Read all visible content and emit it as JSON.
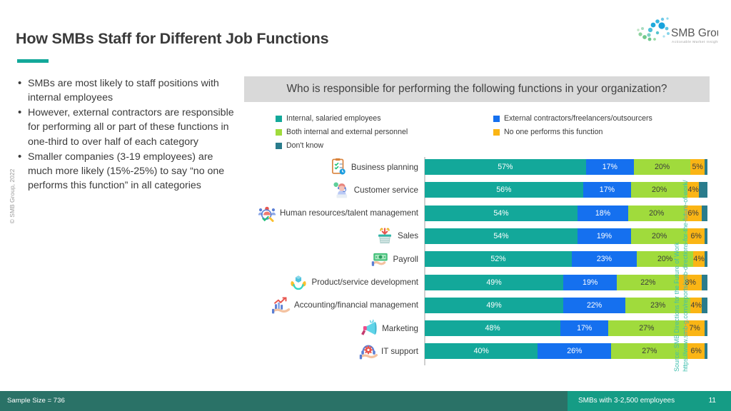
{
  "slide": {
    "title": "How SMBs Staff for Different Job Functions",
    "copyright": "© SMB Group, 2022",
    "accent_color": "#13A89A"
  },
  "logo": {
    "name": "SMB Group",
    "tagline": "Actionable Market Insight"
  },
  "bullets": [
    "SMBs are most likely to staff positions with internal employees",
    "However, external contractors are responsible for performing all or part of these functions in one-third to over half of each category",
    "Smaller companies (3-19 employees) are much more likely  (15%-25%) to say “no one performs this function” in all categories"
  ],
  "question_banner": "Who is responsible for performing the following functions in your organization?",
  "source": {
    "line1": "Source: SMB Directions for the Future of Work",
    "line2": "https://www.smb-g.com/reports/smb-directions-for-the-future-of-work/"
  },
  "footer": {
    "sample_size": "Sample Size = 736",
    "audience": "SMBs with 3-2,500 employees",
    "page_number": "11",
    "left_color": "#2A7267",
    "right_color": "#159C85"
  },
  "chart_data": {
    "type": "bar",
    "subtype": "stacked-horizontal-100",
    "title": "Who is responsible for performing the following functions in your organization?",
    "xlabel": "",
    "ylabel": "",
    "xlim": [
      0,
      100
    ],
    "grid": false,
    "legend_position": "top",
    "categories": [
      "Business planning",
      "Customer service",
      "Human resources/talent management",
      "Sales",
      "Payroll",
      "Product/service development",
      "Accounting/financial management",
      "Marketing",
      "IT support"
    ],
    "category_icons": [
      "clipboard-checklist-icon",
      "customer-service-agent-icon",
      "hr-people-magnifier-icon",
      "sales-basket-icon",
      "payroll-money-icon",
      "product-development-hands-icon",
      "accounting-growth-chart-icon",
      "marketing-megaphone-icon",
      "it-support-headset-gear-icon"
    ],
    "series": [
      {
        "name": "Internal, salaried employees",
        "color": "#13A89A",
        "values": [
          57,
          56,
          54,
          54,
          52,
          49,
          49,
          48,
          40
        ],
        "labels": [
          "57%",
          "56%",
          "54%",
          "54%",
          "52%",
          "49%",
          "49%",
          "48%",
          "40%"
        ]
      },
      {
        "name": "External contractors/freelancers/outsourcers",
        "color": "#1570EF",
        "values": [
          17,
          17,
          18,
          19,
          23,
          19,
          22,
          17,
          26
        ],
        "labels": [
          "17%",
          "17%",
          "18%",
          "19%",
          "23%",
          "19%",
          "22%",
          "17%",
          "26%"
        ]
      },
      {
        "name": "Both internal and external personnel",
        "color": "#A0DB3C",
        "values": [
          20,
          20,
          20,
          20,
          20,
          22,
          23,
          27,
          27
        ],
        "labels": [
          "20%",
          "20%",
          "20%",
          "20%",
          "20%",
          "22%",
          "23%",
          "27%",
          "27%"
        ]
      },
      {
        "name": "No one performs this function",
        "color": "#FAB515",
        "values": [
          5,
          4,
          6,
          6,
          4,
          8,
          4,
          7,
          6
        ],
        "labels": [
          "5%",
          "4%",
          "6%",
          "6%",
          "4%",
          "8%",
          "4%",
          "7%",
          "6%"
        ]
      },
      {
        "name": "Don't know",
        "color": "#2A7C8C",
        "values": [
          1,
          3,
          2,
          1,
          1,
          2,
          2,
          1,
          1
        ],
        "labels": [
          "1%",
          "3%",
          "2%",
          "1%",
          "1%",
          "2%",
          "2%",
          "1%",
          "1%"
        ]
      }
    ]
  }
}
